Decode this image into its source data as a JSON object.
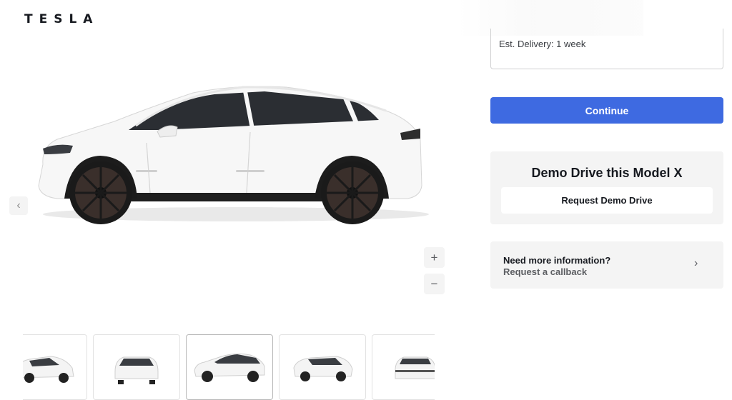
{
  "brand": {
    "logo_text": "TESLA"
  },
  "viewer": {
    "prev_label": "‹",
    "zoom_in_label": "+",
    "zoom_out_label": "−"
  },
  "order": {
    "delivery_text": "Est. Delivery: 1 week",
    "continue_label": "Continue"
  },
  "demo": {
    "title": "Demo Drive this Model X",
    "button_label": "Request Demo Drive"
  },
  "info": {
    "line1": "Need more information?",
    "line2": "Request a callback",
    "chevron": "›"
  },
  "thumbnails": [
    "front-three-quarter",
    "front",
    "side",
    "rear-three-quarter",
    "rear"
  ],
  "colors": {
    "accent": "#3e6ae1",
    "panel": "#f4f4f4",
    "text": "#171a20"
  }
}
